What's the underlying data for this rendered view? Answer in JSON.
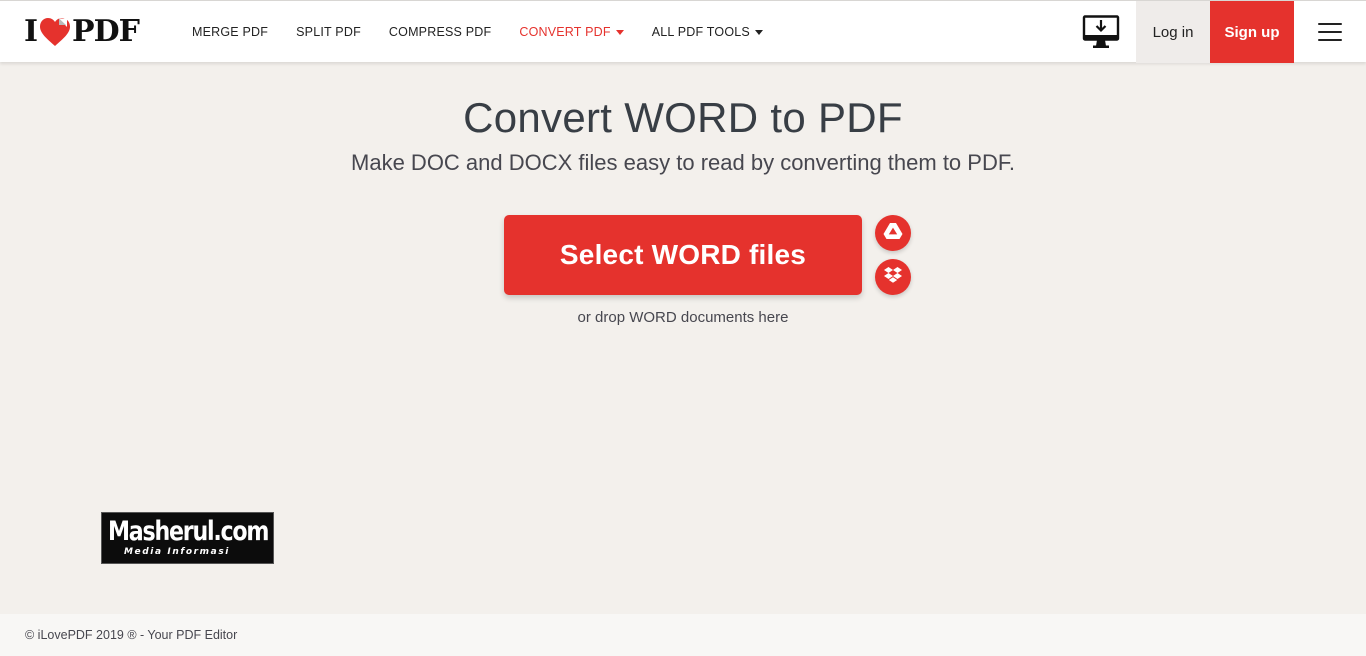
{
  "header": {
    "logo": {
      "left": "I",
      "right": "PDF"
    },
    "nav": [
      {
        "label": "MERGE PDF",
        "active": false,
        "dropdown": false
      },
      {
        "label": "SPLIT PDF",
        "active": false,
        "dropdown": false
      },
      {
        "label": "COMPRESS PDF",
        "active": false,
        "dropdown": false
      },
      {
        "label": "CONVERT PDF",
        "active": true,
        "dropdown": true
      },
      {
        "label": "ALL PDF TOOLS",
        "active": false,
        "dropdown": true
      }
    ],
    "desktop_icon": "desktop-download-icon",
    "login_label": "Log in",
    "signup_label": "Sign up",
    "menu_icon": "hamburger-menu-icon"
  },
  "main": {
    "title": "Convert WORD to PDF",
    "subtitle": "Make DOC and DOCX files easy to read by converting them to PDF.",
    "select_button_label": "Select WORD files",
    "cloud_buttons": [
      {
        "icon": "google-drive-icon"
      },
      {
        "icon": "dropbox-icon"
      }
    ],
    "drop_hint": "or drop WORD documents here"
  },
  "watermark": {
    "title": "Masherul.com",
    "subtitle": "Media Informasi"
  },
  "footer": {
    "text": "© iLovePDF 2019 ® - Your PDF Editor"
  },
  "colors": {
    "brand_red": "#e5322d",
    "background": "#f3f0ec",
    "header_bg": "#ffffff",
    "login_bg": "#efecea"
  }
}
